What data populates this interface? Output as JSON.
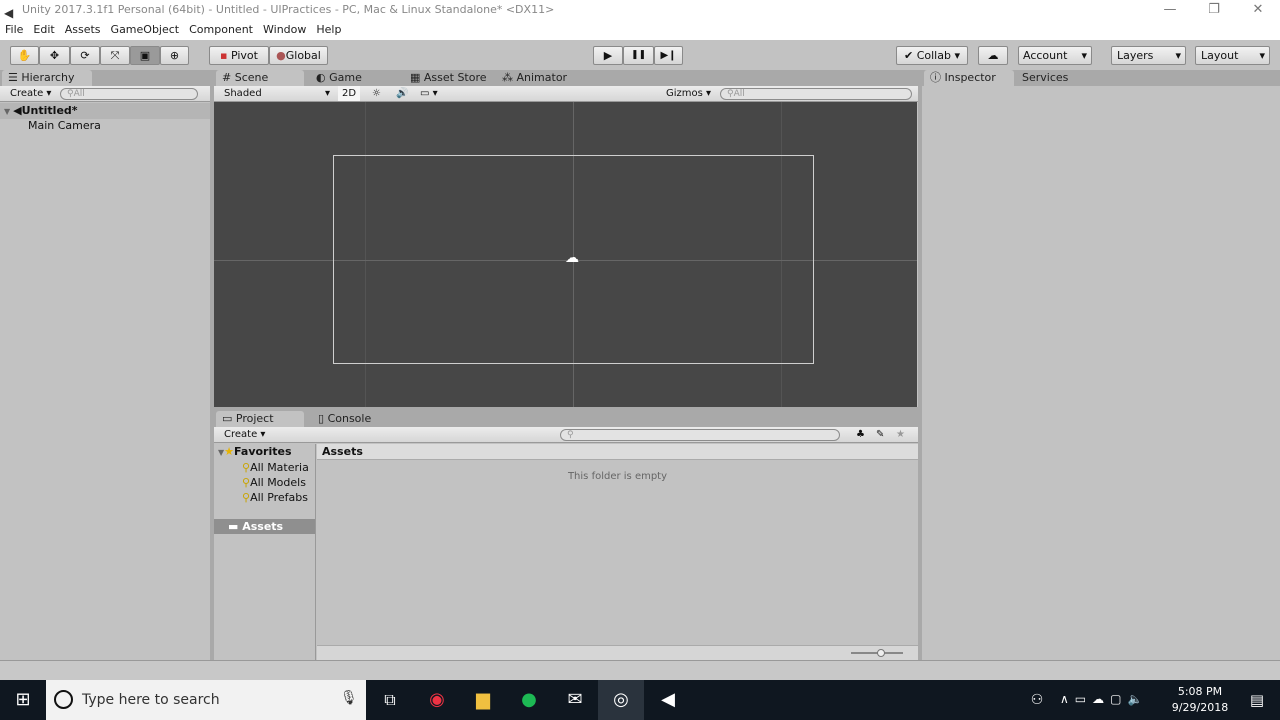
{
  "window": {
    "title": "Unity 2017.3.1f1 Personal (64bit) - Untitled - UIPractices - PC, Mac & Linux Standalone* <DX11>",
    "minimize": "—",
    "restore": "❐",
    "close": "✕"
  },
  "menu": [
    "File",
    "Edit",
    "Assets",
    "GameObject",
    "Component",
    "Window",
    "Help"
  ],
  "toolbar": {
    "tools": [
      "hand-tool",
      "move-tool",
      "rotate-tool",
      "scale-tool",
      "rect-tool",
      "transform-tool"
    ],
    "pivot": "Pivot",
    "global": "Global",
    "play": "▶",
    "pause": "❚❚",
    "step": "▶❙",
    "collab": "Collab",
    "account": "Account",
    "layers": "Layers",
    "layout": "Layout"
  },
  "hierarchy": {
    "tab": "Hierarchy",
    "create": "Create",
    "search_placeholder": "All",
    "scene": "Untitled*",
    "items": [
      "Main Camera"
    ]
  },
  "scene_view": {
    "tabs": [
      "Scene",
      "Game",
      "Asset Store",
      "Animator"
    ],
    "shading": "Shaded",
    "mode_2d": "2D",
    "gizmos": "Gizmos",
    "search_placeholder": "All"
  },
  "inspector": {
    "tabs": [
      "Inspector",
      "Services"
    ]
  },
  "project": {
    "tabs": [
      "Project",
      "Console"
    ],
    "create": "Create",
    "favorites": "Favorites",
    "favorite_items": [
      "All Materia",
      "All Models",
      "All Prefabs"
    ],
    "assets_root": "Assets",
    "breadcrumb": "Assets",
    "empty_message": "This folder is empty"
  },
  "taskbar": {
    "search_placeholder": "Type here to search",
    "time": "5:08 PM",
    "date": "9/29/2018"
  }
}
